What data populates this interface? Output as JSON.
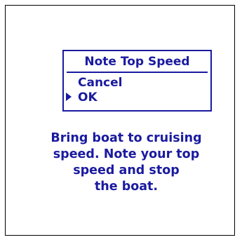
{
  "menu": {
    "title": "Note Top Speed",
    "items": [
      {
        "label": "Cancel",
        "selected": false
      },
      {
        "label": "OK",
        "selected": true
      }
    ]
  },
  "instructions": {
    "lines": [
      "Bring boat to cruising",
      "speed. Note your top",
      "speed and stop",
      "the boat."
    ]
  },
  "colors": {
    "text": "#1a1aa0",
    "background": "#ffffff",
    "border": "#000000"
  },
  "icons": {
    "selection_cursor": "right-triangle-arrow"
  }
}
